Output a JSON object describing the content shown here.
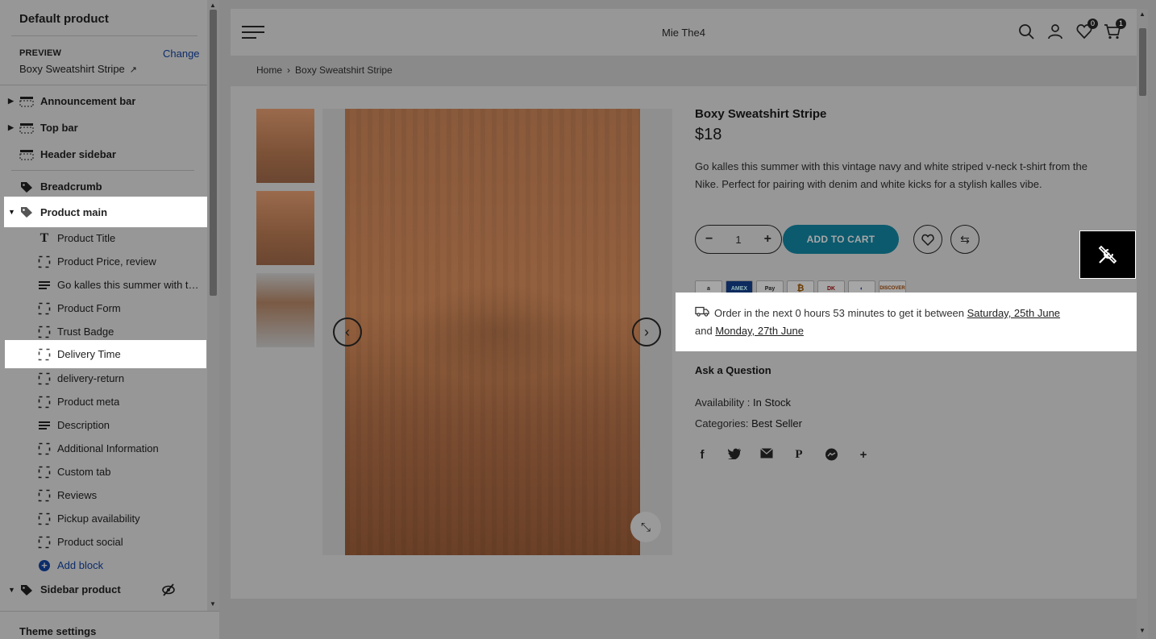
{
  "sidebar": {
    "title": "Default product",
    "preview_label": "PREVIEW",
    "change_label": "Change",
    "preview_value": "Boxy Sweatshirt Stripe",
    "items": [
      {
        "label": "Announcement bar",
        "icon": "section-icon"
      },
      {
        "label": "Top bar",
        "icon": "section-icon"
      },
      {
        "label": "Header sidebar",
        "icon": "section-icon"
      },
      {
        "label": "Breadcrumb",
        "icon": "tag-icon"
      },
      {
        "label": "Product main",
        "icon": "tag-icon"
      },
      {
        "label": "Product Title",
        "icon": "text-icon"
      },
      {
        "label": "Product Price, review",
        "icon": "block-icon"
      },
      {
        "label": "Go kalles this summer with th...",
        "icon": "lines-icon"
      },
      {
        "label": "Product Form",
        "icon": "block-icon"
      },
      {
        "label": "Trust Badge",
        "icon": "block-icon"
      },
      {
        "label": "Delivery Time",
        "icon": "block-icon"
      },
      {
        "label": "delivery-return",
        "icon": "block-icon"
      },
      {
        "label": "Product meta",
        "icon": "block-icon"
      },
      {
        "label": "Description",
        "icon": "lines-icon"
      },
      {
        "label": "Additional Information",
        "icon": "block-icon"
      },
      {
        "label": "Custom tab",
        "icon": "block-icon"
      },
      {
        "label": "Reviews",
        "icon": "block-icon"
      },
      {
        "label": "Pickup availability",
        "icon": "block-icon"
      },
      {
        "label": "Product social",
        "icon": "block-icon"
      },
      {
        "label": "Add block",
        "icon": "plus-circle-icon"
      },
      {
        "label": "Sidebar product",
        "icon": "tag-icon"
      }
    ],
    "footer_label": "Theme settings"
  },
  "store": {
    "name": "Mie The4",
    "wishlist_count": "0",
    "cart_count": "1"
  },
  "breadcrumb": {
    "home": "Home",
    "separator": "›",
    "current": "Boxy Sweatshirt Stripe"
  },
  "product": {
    "title": "Boxy Sweatshirt Stripe",
    "price": "$18",
    "description": "Go kalles this summer with this vintage navy and white striped v-neck t-shirt from the Nike. Perfect for pairing with denim and white kicks for a stylish kalles vibe.",
    "quantity": "1",
    "add_to_cart": "ADD TO CART",
    "payments": [
      "a",
      "AMEX",
      "Pay",
      "₿",
      "DK",
      "◐",
      "DISCOVER"
    ],
    "delivery_prefix": "Order in the next 0 hours 53 minutes to get it between",
    "delivery_date_1": "Saturday, 25th June",
    "delivery_and": "and",
    "delivery_date_2": "Monday, 27th June",
    "ask_question": "Ask a Question",
    "availability_label": "Availability :",
    "availability_value": "In Stock",
    "categories_label": "Categories:",
    "categories_value": "Best Seller"
  },
  "colors": {
    "overlay": "#979797",
    "accent_button": "#0c5a6e",
    "highlight": "#ffffff",
    "link": "#0c2c6b"
  }
}
